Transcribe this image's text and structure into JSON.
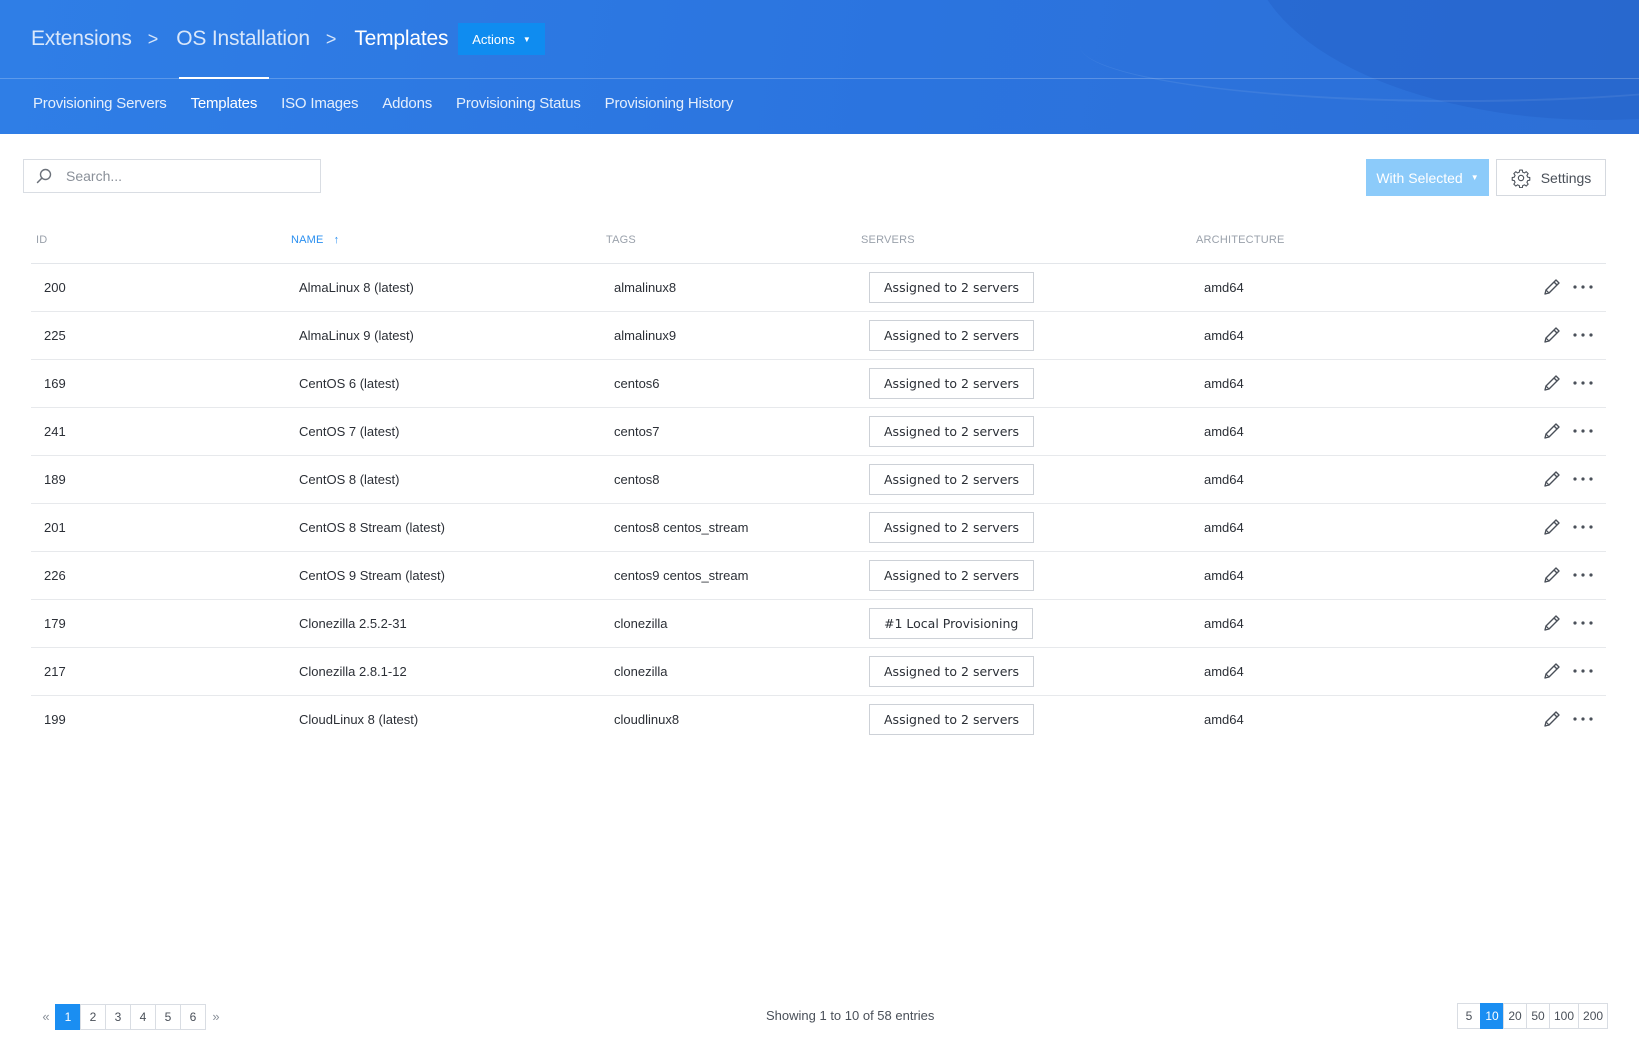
{
  "breadcrumb": {
    "items": [
      "Extensions",
      "OS Installation",
      "Templates"
    ],
    "actions_label": "Actions"
  },
  "tabs": [
    {
      "label": "Provisioning Servers",
      "active": false
    },
    {
      "label": "Templates",
      "active": true
    },
    {
      "label": "ISO Images",
      "active": false
    },
    {
      "label": "Addons",
      "active": false
    },
    {
      "label": "Provisioning Status",
      "active": false
    },
    {
      "label": "Provisioning History",
      "active": false
    }
  ],
  "toolbar": {
    "search_placeholder": "Search...",
    "with_selected_label": "With Selected",
    "settings_label": "Settings"
  },
  "table": {
    "columns": {
      "id": "ID",
      "name": "NAME",
      "tags": "TAGS",
      "servers": "SERVERS",
      "architecture": "ARCHITECTURE"
    },
    "sorted_column": "name",
    "rows": [
      {
        "id": "200",
        "name": "AlmaLinux 8 (latest)",
        "tags": "almalinux8",
        "servers": "Assigned to 2 servers",
        "arch": "amd64"
      },
      {
        "id": "225",
        "name": "AlmaLinux 9 (latest)",
        "tags": "almalinux9",
        "servers": "Assigned to 2 servers",
        "arch": "amd64"
      },
      {
        "id": "169",
        "name": "CentOS 6 (latest)",
        "tags": "centos6",
        "servers": "Assigned to 2 servers",
        "arch": "amd64"
      },
      {
        "id": "241",
        "name": "CentOS 7 (latest)",
        "tags": "centos7",
        "servers": "Assigned to 2 servers",
        "arch": "amd64"
      },
      {
        "id": "189",
        "name": "CentOS 8 (latest)",
        "tags": "centos8",
        "servers": "Assigned to 2 servers",
        "arch": "amd64"
      },
      {
        "id": "201",
        "name": "CentOS 8 Stream (latest)",
        "tags": "centos8 centos_stream",
        "servers": "Assigned to 2 servers",
        "arch": "amd64"
      },
      {
        "id": "226",
        "name": "CentOS 9 Stream (latest)",
        "tags": "centos9 centos_stream",
        "servers": "Assigned to 2 servers",
        "arch": "amd64"
      },
      {
        "id": "179",
        "name": "Clonezilla 2.5.2-31",
        "tags": "clonezilla",
        "servers": "#1 Local Provisioning",
        "arch": "amd64"
      },
      {
        "id": "217",
        "name": "Clonezilla 2.8.1-12",
        "tags": "clonezilla",
        "servers": "Assigned to 2 servers",
        "arch": "amd64"
      },
      {
        "id": "199",
        "name": "CloudLinux 8 (latest)",
        "tags": "cloudlinux8",
        "servers": "Assigned to 2 servers",
        "arch": "amd64"
      }
    ]
  },
  "pagination": {
    "pages": [
      "1",
      "2",
      "3",
      "4",
      "5",
      "6"
    ],
    "current_page": "1",
    "info": "Showing 1 to 10 of 58 entries",
    "page_sizes": [
      "5",
      "10",
      "20",
      "50",
      "100",
      "200"
    ],
    "current_size": "10"
  },
  "colors": {
    "header_bg": "#2b74df",
    "accent": "#1a8ef2",
    "with_selected_bg": "#8ccbfa"
  }
}
